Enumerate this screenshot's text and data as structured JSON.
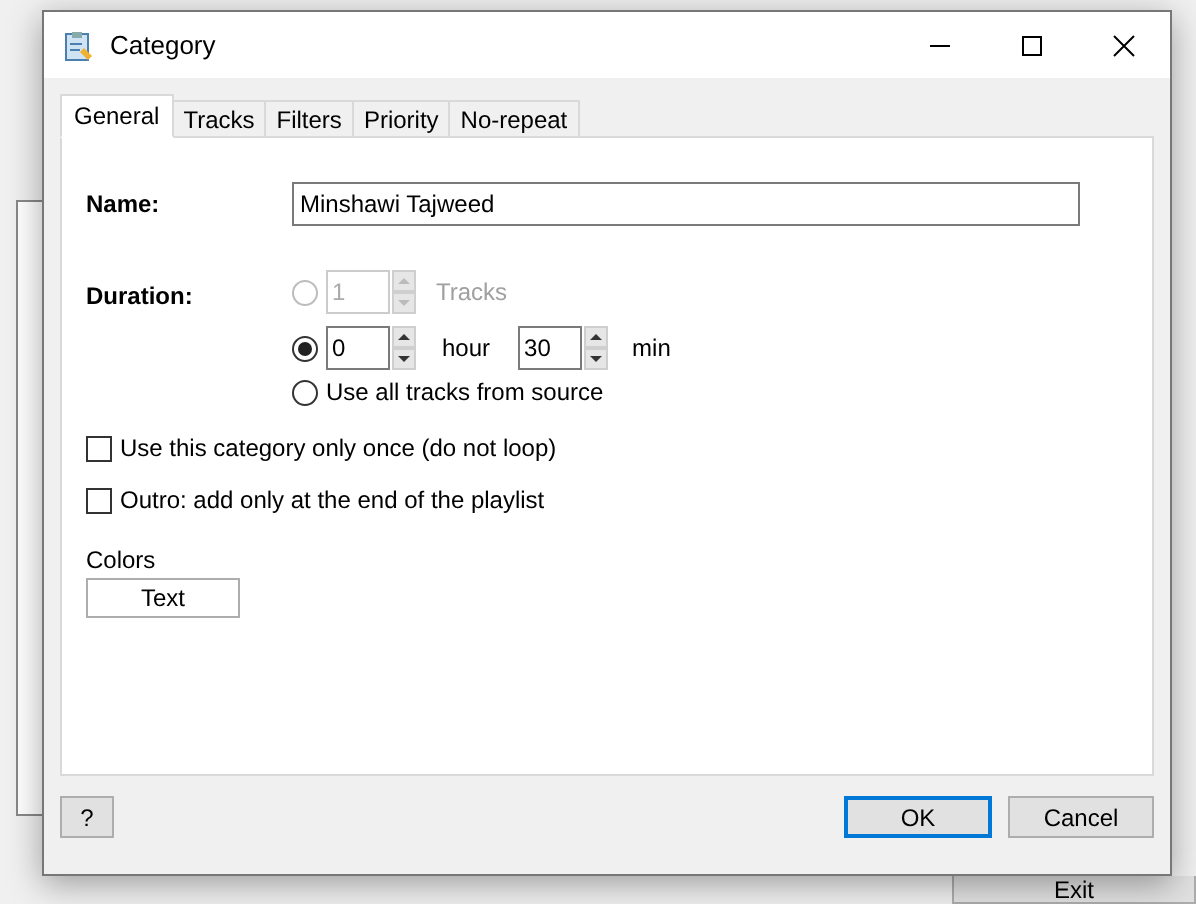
{
  "background_window": {
    "exit_button": "Exit"
  },
  "dialog": {
    "title": "Category",
    "tabs": [
      {
        "label": "General",
        "selected": true
      },
      {
        "label": "Tracks",
        "selected": false
      },
      {
        "label": "Filters",
        "selected": false
      },
      {
        "label": "Priority",
        "selected": false
      },
      {
        "label": "No-repeat",
        "selected": false
      }
    ],
    "name": {
      "label": "Name:",
      "value": "Minshawi Tajweed"
    },
    "duration": {
      "label": "Duration:",
      "options": [
        {
          "kind": "tracks",
          "selected": false,
          "disabled": true,
          "value": "1",
          "unit": "Tracks"
        },
        {
          "kind": "time",
          "selected": true,
          "hours": "0",
          "hour_unit": "hour",
          "minutes": "30",
          "min_unit": "min"
        },
        {
          "kind": "all",
          "selected": false,
          "label": "Use all tracks from source"
        }
      ]
    },
    "checkboxes": [
      {
        "label": "Use this category only once (do not loop)",
        "checked": false
      },
      {
        "label": "Outro: add only at the end of the playlist",
        "checked": false
      }
    ],
    "colors": {
      "label": "Colors",
      "button": "Text"
    },
    "buttons": {
      "help": "?",
      "ok": "OK",
      "cancel": "Cancel"
    }
  }
}
